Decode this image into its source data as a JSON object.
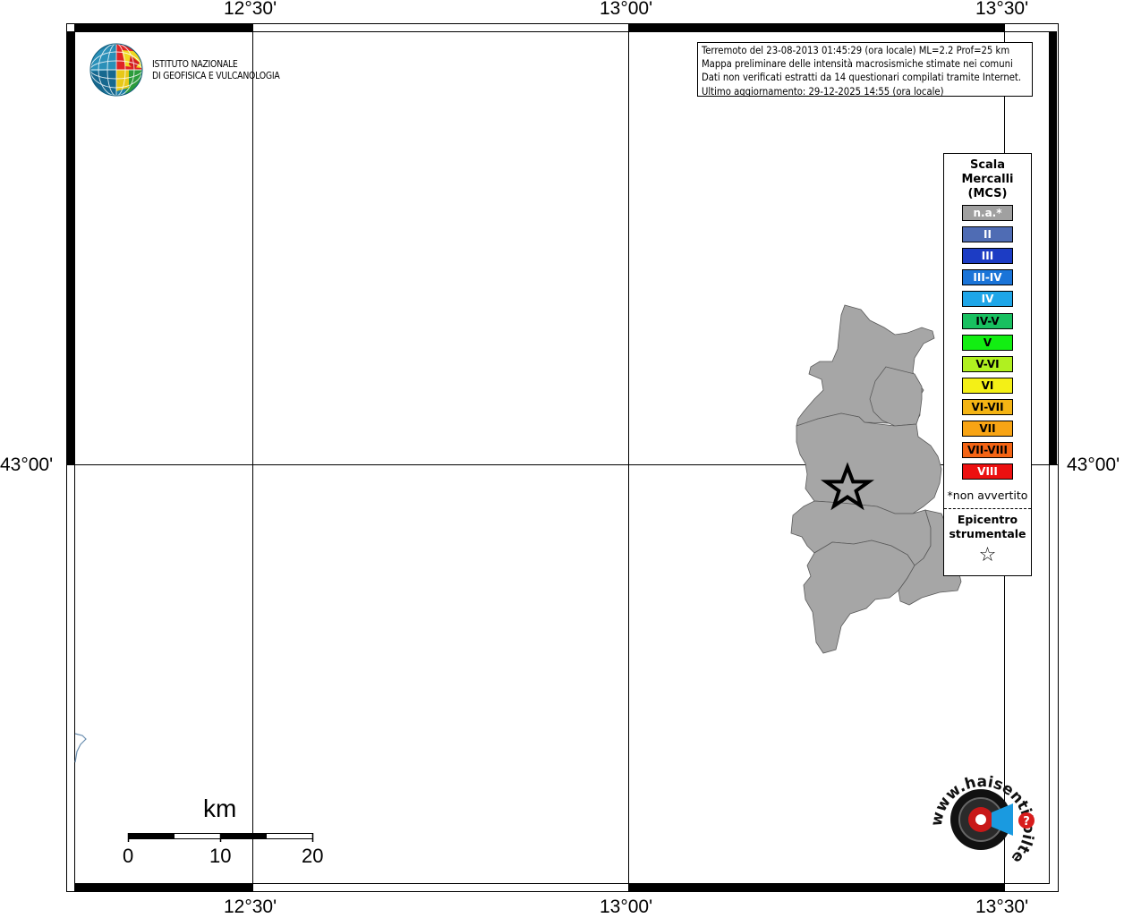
{
  "map": {
    "top_labels": [
      "12°30'",
      "13°00'",
      "13°30'"
    ],
    "bottom_labels": [
      "12°30'",
      "13°00'",
      "13°30'"
    ],
    "left_label": "43°00'",
    "right_label": "43°00'"
  },
  "institute": {
    "line1": "ISTITUTO NAZIONALE",
    "line2": "DI GEOFISICA E VULCANOLOGIA"
  },
  "info": {
    "line1": "Terremoto del 23-08-2013 01:45:29 (ora locale) ML=2.2 Prof=25 km",
    "line2": "Mappa preliminare delle intensità macrosismiche stimate nei comuni",
    "line3": "Dati non verificati estratti da 14 questionari compilati tramite Internet.",
    "line4": "Ultimo aggiornamento: 29-12-2025 14:55 (ora locale)"
  },
  "legend": {
    "title_lines": [
      "Scala",
      "Mercalli",
      "(MCS)"
    ],
    "items": [
      {
        "label": "n.a.*",
        "color": "#a0a0a0",
        "text_color": "#ffffff"
      },
      {
        "label": "II",
        "color": "#4f6cb4",
        "text_color": "#ffffff"
      },
      {
        "label": "III",
        "color": "#1c3cc4",
        "text_color": "#ffffff"
      },
      {
        "label": "III-IV",
        "color": "#1a74d8",
        "text_color": "#ffffff"
      },
      {
        "label": "IV",
        "color": "#1ea6e8",
        "text_color": "#ffffff"
      },
      {
        "label": "IV-V",
        "color": "#18c060",
        "text_color": "#000000"
      },
      {
        "label": "V",
        "color": "#12ee12",
        "text_color": "#000000"
      },
      {
        "label": "V-VI",
        "color": "#b0f020",
        "text_color": "#000000"
      },
      {
        "label": "VI",
        "color": "#f4f016",
        "text_color": "#000000"
      },
      {
        "label": "VI-VII",
        "color": "#f4b414",
        "text_color": "#000000"
      },
      {
        "label": "VII",
        "color": "#f8a414",
        "text_color": "#000000"
      },
      {
        "label": "VII-VIII",
        "color": "#f46414",
        "text_color": "#000000"
      },
      {
        "label": "VIII",
        "color": "#ec1010",
        "text_color": "#ffffff"
      }
    ],
    "note": "*non avvertito",
    "epicenter_lines": [
      "Epicentro",
      "strumentale"
    ],
    "epicenter_symbol": "☆"
  },
  "scale_bar": {
    "unit": "km",
    "ticks": [
      "0",
      "10",
      "20"
    ]
  },
  "logo2": {
    "text": "www.haisentitoilterremoto.it"
  }
}
